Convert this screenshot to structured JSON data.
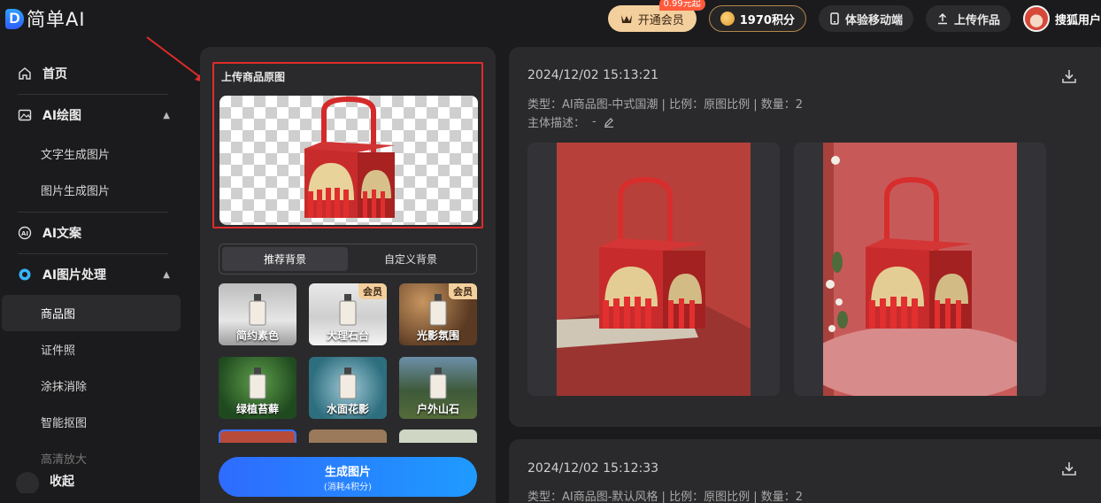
{
  "logo": {
    "mark": "D",
    "text": "简单AI"
  },
  "top": {
    "vip_label": "开通会员",
    "vip_badge": "0.99元起",
    "points": "1970积分",
    "mobile_label": "体验移动端",
    "upload_label": "上传作品",
    "username": "搜狐用户"
  },
  "sidebar": {
    "home": "首页",
    "ai_draw": "AI绘图",
    "text_to_image": "文字生成图片",
    "image_to_image": "图片生成图片",
    "ai_copy": "AI文案",
    "ai_image_proc": "AI图片处理",
    "product_image": "商品图",
    "id_photo": "证件照",
    "erase": "涂抹消除",
    "smart_cutout": "智能抠图",
    "hd_upscale": "高清放大",
    "collapse": "收起"
  },
  "panel": {
    "upload_title": "上传商品原图",
    "tab_recommended": "推荐背景",
    "tab_custom": "自定义背景",
    "member_badge": "会员",
    "tiles": [
      {
        "label": "简约素色",
        "member": false
      },
      {
        "label": "大理石台",
        "member": true
      },
      {
        "label": "光影氛围",
        "member": true
      },
      {
        "label": "绿植苔藓",
        "member": false
      },
      {
        "label": "水面花影",
        "member": false
      },
      {
        "label": "户外山石",
        "member": false
      }
    ],
    "generate_label": "生成图片",
    "generate_cost": "(消耗4积分)"
  },
  "results": [
    {
      "time": "2024/12/02 15:13:21",
      "meta": "类型：AI商品图-中式国潮 | 比例：原图比例 | 数量：2",
      "subject_label": "主体描述：",
      "subject_value": "-"
    },
    {
      "time": "2024/12/02 15:12:33",
      "meta": "类型：AI商品图-默认风格 | 比例：原图比例 | 数量：2"
    }
  ],
  "colors": {
    "accent": "#2f6bff",
    "highlight_frame": "#e02b2b",
    "vip": "#f3cf9d"
  }
}
